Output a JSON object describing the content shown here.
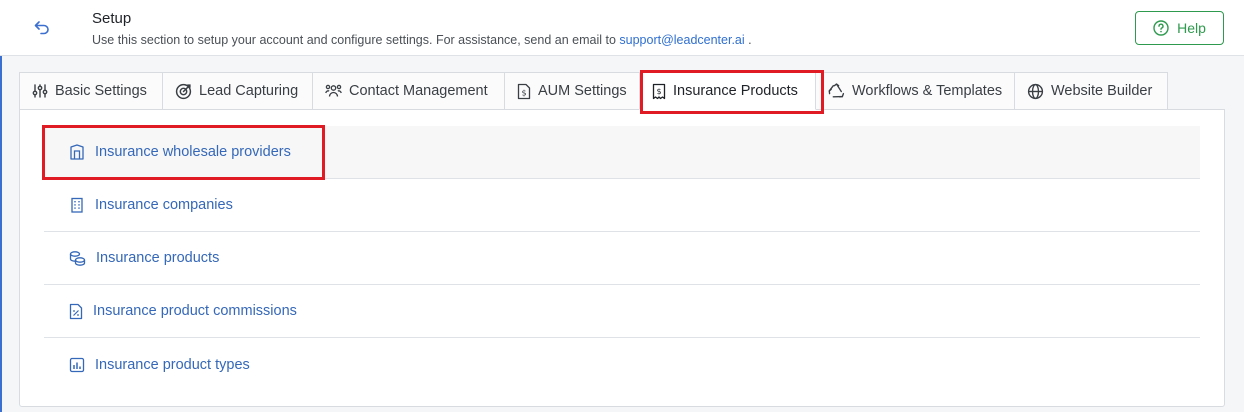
{
  "header": {
    "title": "Setup",
    "subtitle_text": "Use this section to setup your account and configure settings. For assistance, send an email to",
    "support_email": "support@leadcenter.ai",
    "subtitle_suffix": " .",
    "help_label": "Help"
  },
  "tabs": [
    {
      "label": "Basic Settings",
      "icon": "sliders-icon"
    },
    {
      "label": "Lead Capturing",
      "icon": "target-icon"
    },
    {
      "label": "Contact Management",
      "icon": "users-icon"
    },
    {
      "label": "AUM Settings",
      "icon": "file-dollar-icon"
    },
    {
      "label": "Insurance Products",
      "icon": "receipt-dollar-icon",
      "active": true
    },
    {
      "label": "Workflows & Templates",
      "icon": "recycle-icon"
    },
    {
      "label": "Website Builder",
      "icon": "globe-icon"
    }
  ],
  "items": [
    {
      "label": "Insurance wholesale providers",
      "icon": "building-icon"
    },
    {
      "label": "Insurance companies",
      "icon": "office-building-icon"
    },
    {
      "label": "Insurance products",
      "icon": "coins-icon"
    },
    {
      "label": "Insurance product commissions",
      "icon": "file-percent-icon"
    },
    {
      "label": "Insurance product types",
      "icon": "chart-bars-icon"
    }
  ],
  "colors": {
    "accent_link": "#3568b8",
    "help_green": "#2e9a4e",
    "highlight_red": "#e01b24"
  }
}
